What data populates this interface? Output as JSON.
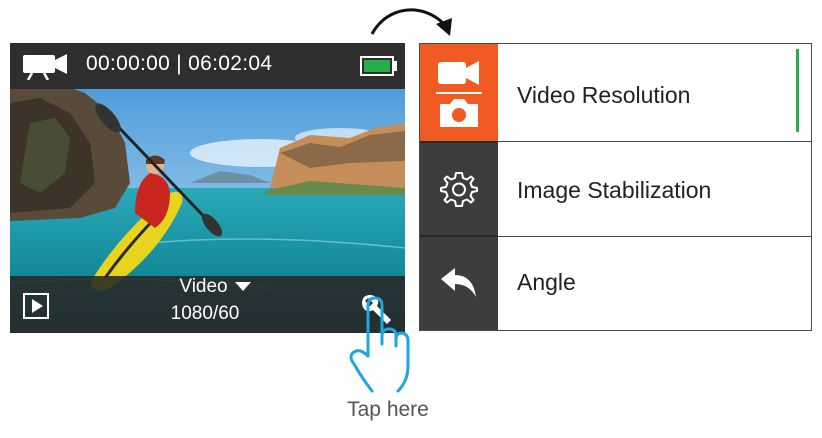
{
  "camera_screen": {
    "timer": "00:00:00 | 06:02:04",
    "mode_label": "Video",
    "resolution": "1080/60",
    "battery_level": 1.0,
    "mode_icon": "video-camera-icon",
    "play_icon": "play-icon",
    "settings_icon": "wrench-icon"
  },
  "instruction": {
    "caption": "Tap here",
    "hand_icon": "tap-hand-icon",
    "arrow_icon": "curved-arrow-icon"
  },
  "menu": {
    "items": [
      {
        "label": "Video Resolution",
        "icon": "video-photo-mode-icon",
        "active": true
      },
      {
        "label": "Image Stabilization",
        "icon": "gear-icon",
        "active": false
      },
      {
        "label": "Angle",
        "icon": "back-arrow-icon",
        "active": false
      }
    ]
  },
  "colors": {
    "accent_orange": "#f15a22",
    "accent_green": "#27ad4a",
    "sidebar_dark": "#3d3d3d",
    "hand_blue": "#1ea7dc"
  }
}
